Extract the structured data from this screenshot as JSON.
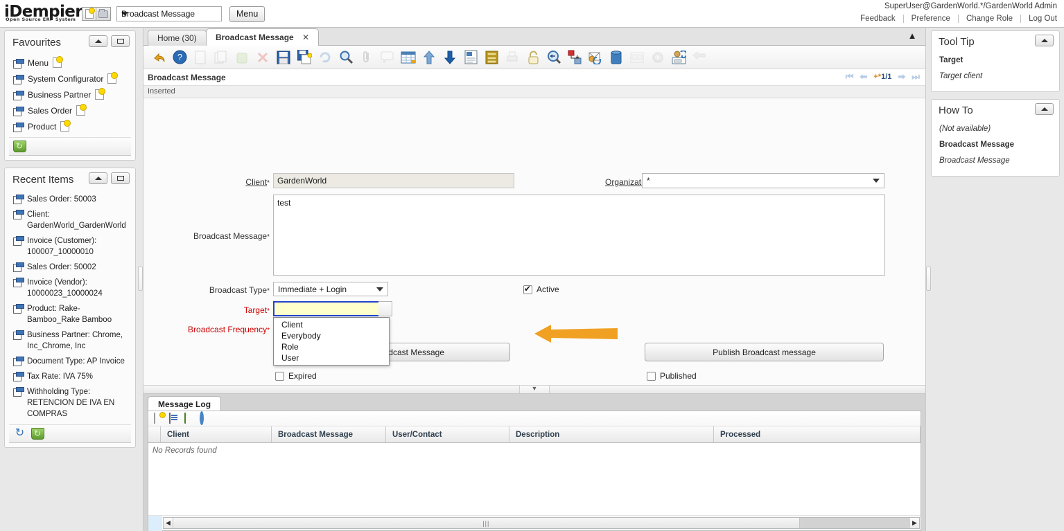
{
  "header": {
    "logo": "iDempiere",
    "logo_sub": "Open Source  ERP System",
    "window_select_value": "Broadcast Message",
    "menu_button": "Menu",
    "user_line": "SuperUser@GardenWorld.*/GardenWorld Admin",
    "links": [
      "Feedback",
      "Preference",
      "Change Role",
      "Log Out"
    ]
  },
  "sidebar": {
    "favourites": {
      "title": "Favourites",
      "items": [
        {
          "label": "Menu"
        },
        {
          "label": "System Configurator"
        },
        {
          "label": "Business Partner"
        },
        {
          "label": "Sales Order"
        },
        {
          "label": "Product"
        }
      ]
    },
    "recent": {
      "title": "Recent Items",
      "items": [
        {
          "label": "Sales Order: 50003"
        },
        {
          "label": "Client: GardenWorld_GardenWorld"
        },
        {
          "label": "Invoice (Customer): 100007_10000010"
        },
        {
          "label": "Sales Order: 50002"
        },
        {
          "label": "Invoice (Vendor): 10000023_10000024"
        },
        {
          "label": "Product: Rake-Bamboo_Rake Bamboo"
        },
        {
          "label": "Business Partner: Chrome, Inc_Chrome, Inc"
        },
        {
          "label": "Document Type: AP Invoice"
        },
        {
          "label": "Tax Rate: IVA 75%"
        },
        {
          "label": "Withholding Type: RETENCION DE IVA EN COMPRAS"
        }
      ]
    }
  },
  "tabs": [
    {
      "label": "Home (30)",
      "active": false,
      "closable": false
    },
    {
      "label": "Broadcast Message",
      "active": true,
      "closable": true,
      "close": "✕"
    }
  ],
  "form": {
    "title": "Broadcast Message",
    "record_nav": {
      "prefix": "+*",
      "counter": "1/1"
    },
    "status": "Inserted",
    "fields": {
      "client": {
        "label": "Client",
        "required_mark": "*",
        "value": "GardenWorld"
      },
      "organization": {
        "label": "Organization",
        "required_mark": "*",
        "value": "*"
      },
      "broadcast_message": {
        "label": "Broadcast Message",
        "required_mark": "*",
        "value": "test"
      },
      "broadcast_type": {
        "label": "Broadcast Type",
        "required_mark": "*",
        "value": "Immediate + Login"
      },
      "target": {
        "label": "Target",
        "required_mark": "*",
        "value": ""
      },
      "broadcast_frequency": {
        "label": "Broadcast Frequency",
        "required_mark": "*",
        "value": ""
      }
    },
    "target_dropdown": {
      "open": true,
      "options": [
        "Client",
        "Everybody",
        "Role",
        "User"
      ]
    },
    "checkboxes": {
      "active": {
        "label": "Active",
        "checked": true
      },
      "expired": {
        "label": "Expired",
        "checked": false
      },
      "published": {
        "label": "Published",
        "checked": false
      }
    },
    "buttons": {
      "preview": "Preview Broadcast Message",
      "publish": "Publish Broadcast message"
    }
  },
  "bottom": {
    "tab_label": "Message Log",
    "columns": [
      "Client",
      "Broadcast Message",
      "User/Contact",
      "Description",
      "Processed"
    ],
    "empty_text": "No Records found",
    "rows": []
  },
  "rightbar": {
    "tooltip": {
      "title": "Tool Tip",
      "field_name": "Target",
      "description": "Target client"
    },
    "howto": {
      "title": "How To",
      "not_available": "(Not available)",
      "field_name": "Broadcast Message",
      "description": "Broadcast Message"
    }
  },
  "colors": {
    "focus_field_bg": "#ffffcc",
    "focus_border": "#2244cc",
    "required_label": "#cc0000",
    "annotation_arrow": "#f0a023",
    "readonly_bg": "#eceae3"
  }
}
